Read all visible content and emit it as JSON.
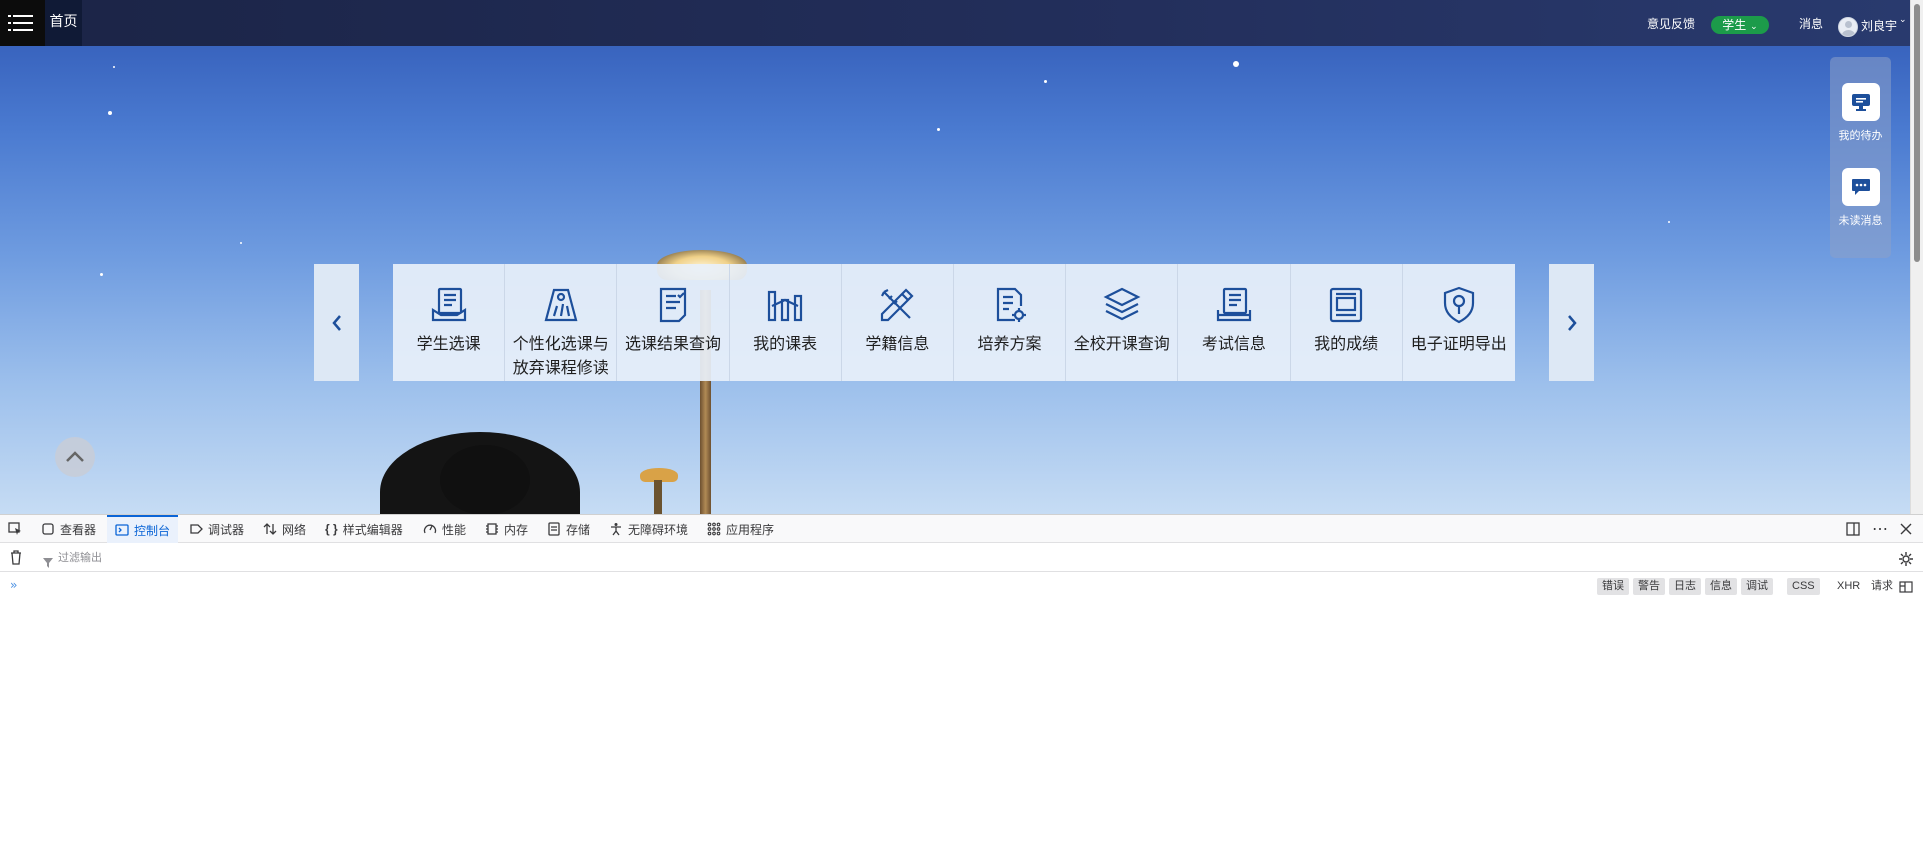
{
  "topbar": {
    "home_label": "首页",
    "feedback_label": "意见反馈",
    "role_label": "学生",
    "messages_label": "消息",
    "username": "刘良宇"
  },
  "side_panel": {
    "todo_label": "我的待办",
    "unread_label": "未读消息"
  },
  "tiles": [
    {
      "label": "学生选课",
      "icon": "course-book-icon"
    },
    {
      "label": "个性化选课与放弃课程修读",
      "icon": "tag-icon"
    },
    {
      "label": "选课结果查询",
      "icon": "checklist-icon"
    },
    {
      "label": "我的课表",
      "icon": "schedule-chart-icon"
    },
    {
      "label": "学籍信息",
      "icon": "ruler-pencil-icon"
    },
    {
      "label": "培养方案",
      "icon": "document-gear-icon"
    },
    {
      "label": "全校开课查询",
      "icon": "layers-icon"
    },
    {
      "label": "考试信息",
      "icon": "exam-book-icon"
    },
    {
      "label": "我的成绩",
      "icon": "grade-card-icon"
    },
    {
      "label": "电子证明导出",
      "icon": "shield-certificate-icon"
    }
  ],
  "devtools": {
    "tabs": [
      "查看器",
      "控制台",
      "调试器",
      "网络",
      "样式编辑器",
      "性能",
      "内存",
      "存储",
      "无障碍环境",
      "应用程序"
    ],
    "active_tab": "控制台",
    "filter_placeholder": "过滤输出",
    "levels": [
      "错误",
      "警告",
      "日志",
      "信息",
      "调试"
    ],
    "extra": [
      "CSS",
      "XHR",
      "请求"
    ],
    "prompt": "»"
  },
  "colors": {
    "topbar": "#1b2446",
    "role_badge": "#1c9b4a",
    "icon_blue": "#1d4f9b",
    "devtools_active": "#0a64d6"
  }
}
